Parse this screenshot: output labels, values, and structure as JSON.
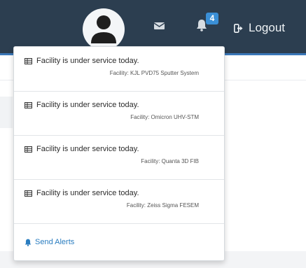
{
  "navbar": {
    "notification_count": "4",
    "logout_label": "Logout",
    "colors": {
      "background": "#2c3e50",
      "badge": "#3a8fd6",
      "text": "#eef2f5"
    }
  },
  "notifications": {
    "items": [
      {
        "title": "Facility is under service today.",
        "facility": "Facility: KJL PVD75 Sputter System"
      },
      {
        "title": "Facility is under service today.",
        "facility": "Facility: Omicron UHV-STM"
      },
      {
        "title": "Facility is under service today.",
        "facility": "Facility: Quanta 3D FIB"
      },
      {
        "title": "Facility is under service today.",
        "facility": "Facility: Zeiss Sigma FESEM"
      }
    ],
    "send_alerts_label": "Send Alerts",
    "link_color": "#2a7dc0"
  }
}
